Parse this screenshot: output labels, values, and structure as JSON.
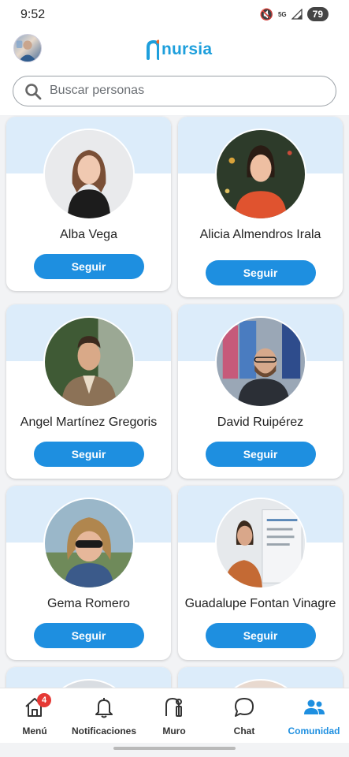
{
  "status_bar": {
    "time": "9:52",
    "network": "5G",
    "battery": "79"
  },
  "header": {
    "logo_text": "nursia",
    "brand_color": "#1e9fdc"
  },
  "search": {
    "placeholder": "Buscar personas"
  },
  "people": [
    {
      "name": "Alba Vega",
      "button": "Seguir"
    },
    {
      "name": "Alicia Almendros Irala",
      "button": "Seguir"
    },
    {
      "name": "Angel Martínez Gregoris",
      "button": "Seguir"
    },
    {
      "name": "David Ruipérez",
      "button": "Seguir"
    },
    {
      "name": "Gema Romero",
      "button": "Seguir"
    },
    {
      "name": "Guadalupe Fontan Vinagre",
      "button": "Seguir"
    }
  ],
  "nav": {
    "items": [
      {
        "label": "Menú",
        "icon": "home-icon",
        "badge": "4",
        "active": false
      },
      {
        "label": "Notificaciones",
        "icon": "bell-icon",
        "active": false
      },
      {
        "label": "Muro",
        "icon": "wall-icon",
        "active": false
      },
      {
        "label": "Chat",
        "icon": "chat-bubble-icon",
        "active": false
      },
      {
        "label": "Comunidad",
        "icon": "community-icon",
        "active": true
      }
    ],
    "active_color": "#1e8fe0"
  },
  "colors": {
    "button": "#1e8fe0",
    "card_band": "#dcecfa",
    "badge": "#e53935"
  }
}
